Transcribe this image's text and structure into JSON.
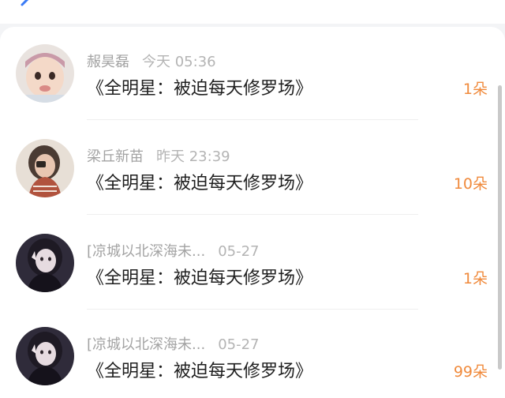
{
  "header": {
    "back_icon": "chevron-left-icon",
    "accent_color": "#3a7bf5"
  },
  "items": [
    {
      "name": "赧昊磊",
      "time": "今天 05:36",
      "title": "《全明星：被迫每天修罗场》",
      "count": "1朵",
      "avatar": "baby-photo"
    },
    {
      "name": "梁丘新苗",
      "time": "昨天 23:39",
      "title": "《全明星：被迫每天修罗场》",
      "count": "10朵",
      "avatar": "girl-photo"
    },
    {
      "name": "[凉城以北深海未...",
      "time": "05-27",
      "title": "《全明星：被迫每天修罗场》",
      "count": "1朵",
      "avatar": "girl-selfie"
    },
    {
      "name": "[凉城以北深海未...",
      "time": "05-27",
      "title": "《全明星：被迫每天修罗场》",
      "count": "99朵",
      "avatar": "girl-selfie"
    }
  ],
  "colors": {
    "count": "#f08a3c",
    "name": "#a3a3a3",
    "title": "#1f1f1f"
  }
}
